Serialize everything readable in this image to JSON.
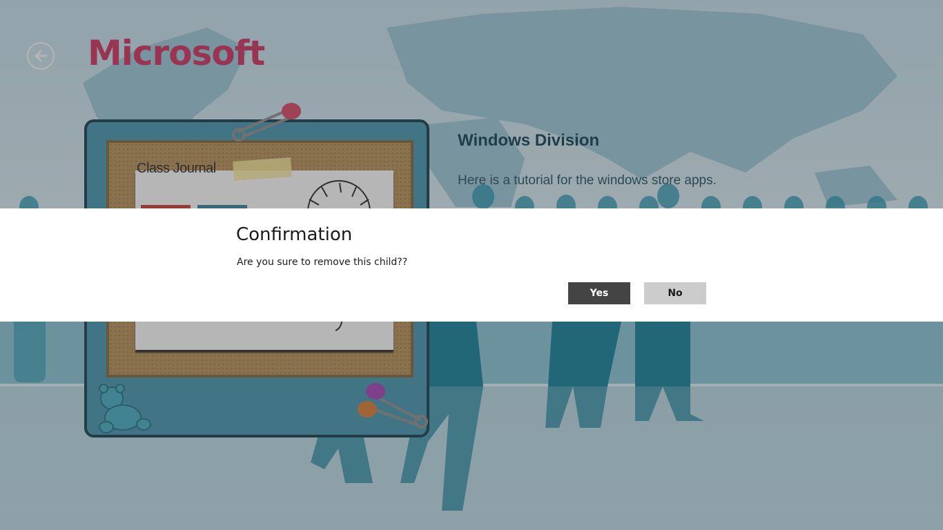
{
  "app": {
    "title": "Microsoft",
    "back_icon": "back-arrow-icon"
  },
  "division": {
    "title": "Windows Division",
    "description": "Here is a tutorial for the windows store apps."
  },
  "journal": {
    "label": "Class Journal"
  },
  "dialog": {
    "title": "Confirmation",
    "message": "Are you sure to remove this child??",
    "yes_label": "Yes",
    "no_label": "No"
  },
  "colors": {
    "brand": "#c72b59",
    "dialog_primary_button": "#444444",
    "dialog_secondary_button": "#cccccc",
    "scene_teal": "#0f7a94"
  }
}
